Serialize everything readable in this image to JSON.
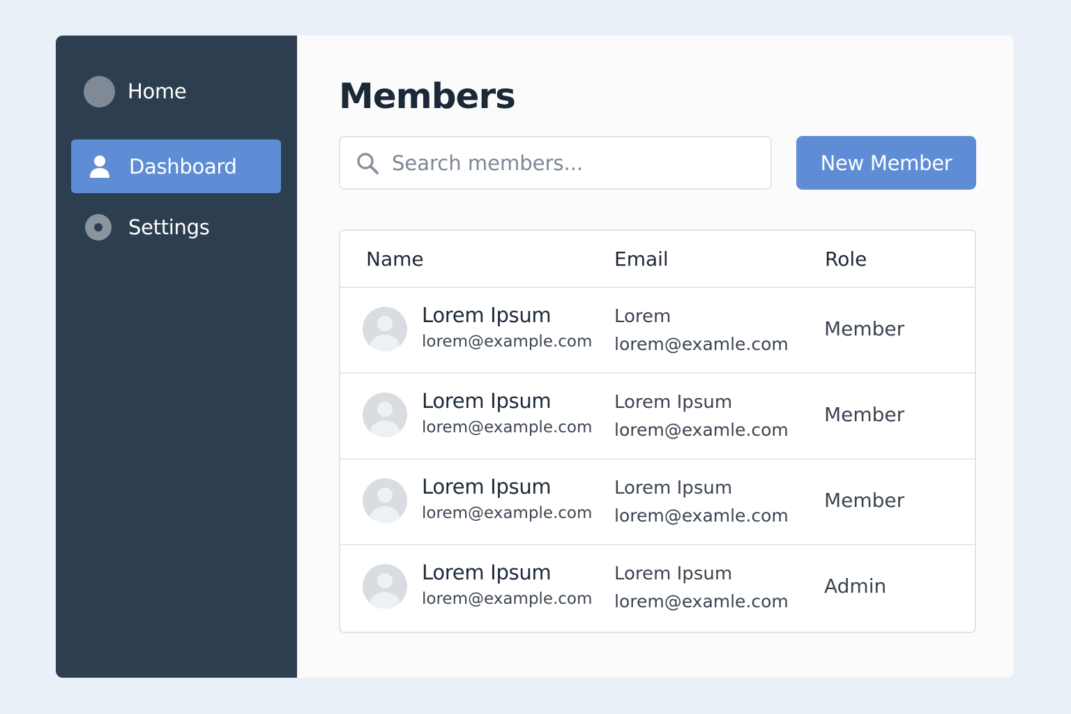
{
  "sidebar": {
    "items": [
      {
        "label": "Home",
        "icon": "home-circle-icon"
      },
      {
        "label": "Dashboard",
        "icon": "user-icon",
        "active": true
      },
      {
        "label": "Settings",
        "icon": "settings-icon"
      }
    ]
  },
  "main": {
    "title": "Members",
    "search": {
      "placeholder": "Search members...",
      "value": ""
    },
    "new_button_label": "New Member",
    "table": {
      "headers": [
        "Name",
        "Email",
        "Role"
      ],
      "rows": [
        {
          "name": "Lorem Ipsum",
          "name_email": "lorem@example.com",
          "email_title": "Lorem",
          "email": "lorem@examle.com",
          "role": "Member"
        },
        {
          "name": "Lorem Ipsum",
          "name_email": "lorem@example.com",
          "email_title": "Lorem Ipsum",
          "email": "lorem@examle.com",
          "role": "Member"
        },
        {
          "name": "Lorem Ipsum",
          "name_email": "lorem@example.com",
          "email_title": "Lorem Ipsum",
          "email": "lorem@examle.com",
          "role": "Member"
        },
        {
          "name": "Lorem Ipsum",
          "name_email": "lorem@example.com",
          "email_title": "Lorem Ipsum",
          "email": "lorem@examle.com",
          "role": "Admin"
        }
      ]
    }
  },
  "colors": {
    "sidebar_bg": "#2c3e50",
    "accent": "#5e8dd6",
    "page_bg": "#eaf0f7"
  }
}
